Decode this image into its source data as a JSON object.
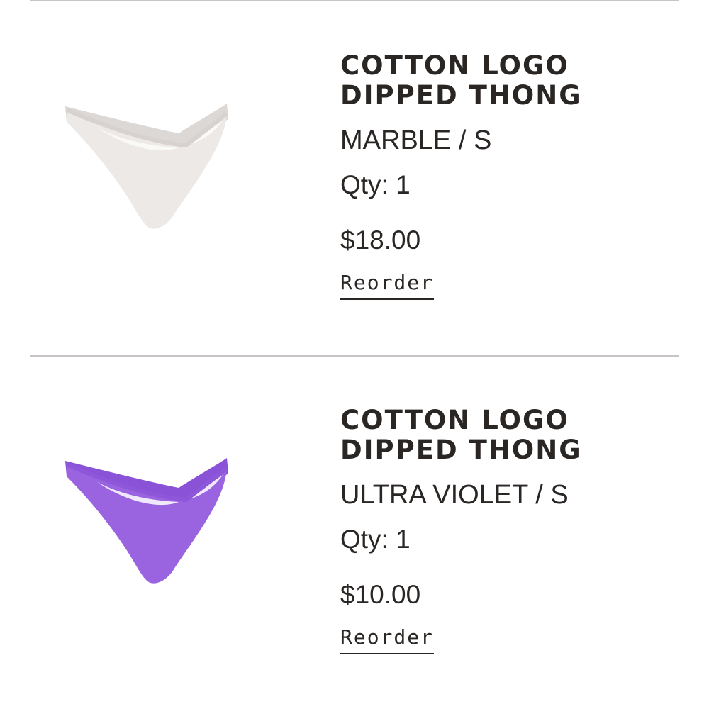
{
  "order_items": [
    {
      "title": "COTTON LOGO DIPPED THONG",
      "variant": "MARBLE / S",
      "qty": "Qty: 1",
      "price": "$18.00",
      "reorder_label": "Reorder",
      "image_color": "#ece9e6",
      "image_icon": "product-thong-image"
    },
    {
      "title": "COTTON LOGO DIPPED THONG",
      "variant": "ULTRA VIOLET / S",
      "qty": "Qty: 1",
      "price": "$10.00",
      "reorder_label": "Reorder",
      "image_color": "#9a63e0",
      "image_icon": "product-thong-image"
    }
  ]
}
